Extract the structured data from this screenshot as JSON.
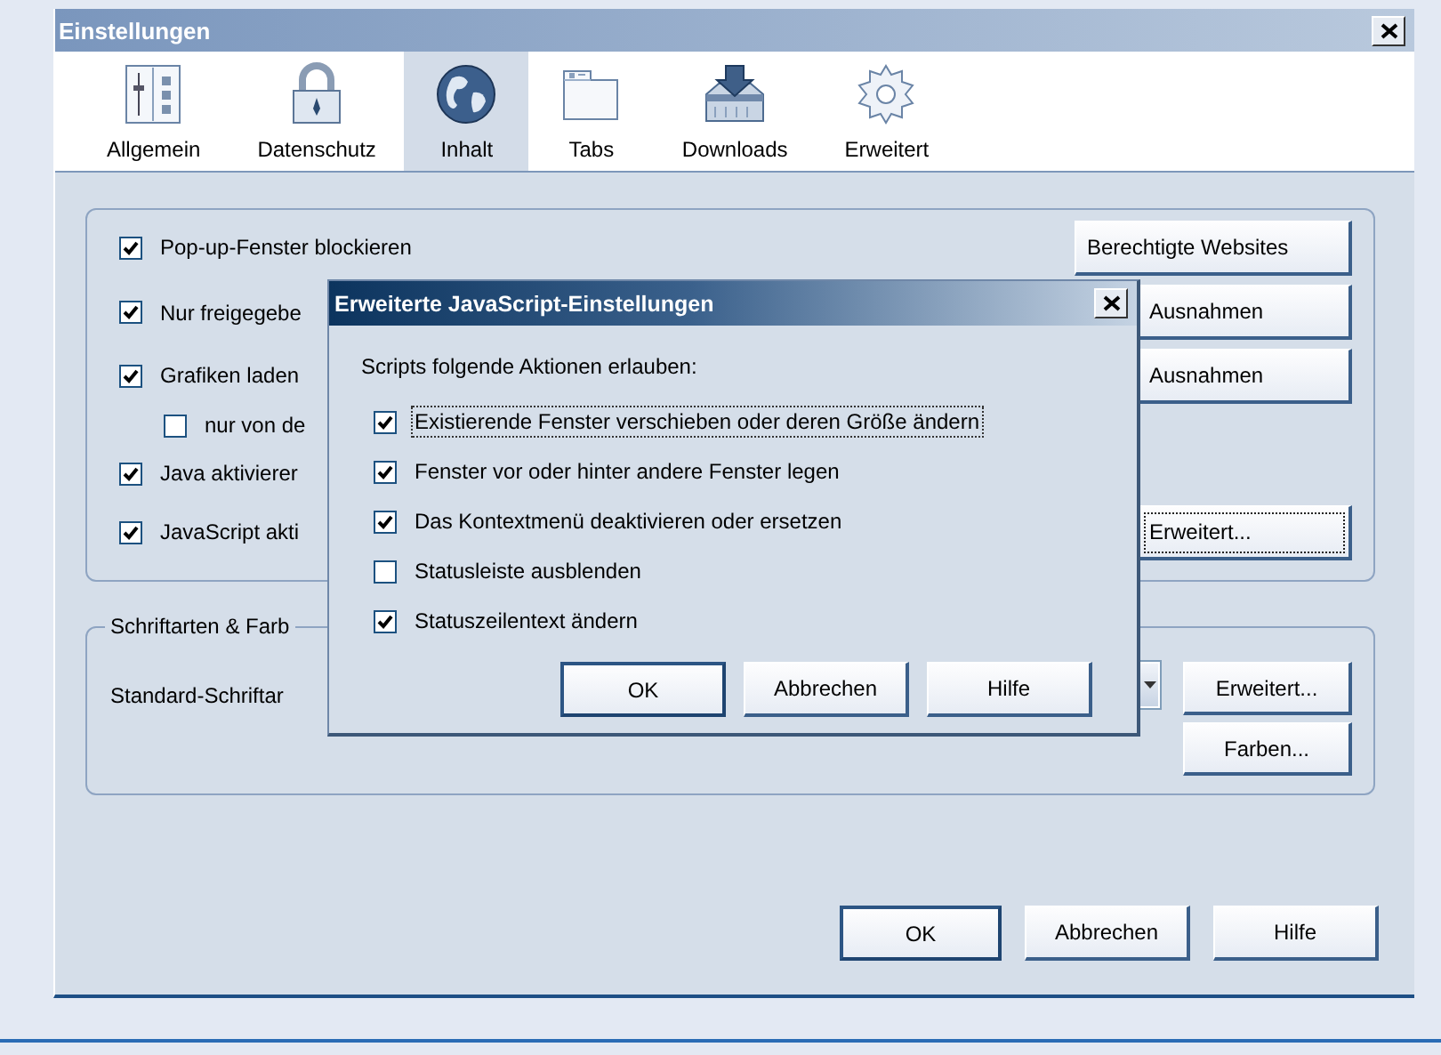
{
  "window": {
    "title": "Einstellungen"
  },
  "toolbar": [
    {
      "label": "Allgemein",
      "kind": "sliders",
      "selected": false
    },
    {
      "label": "Datenschutz",
      "kind": "lock",
      "selected": false
    },
    {
      "label": "Inhalt",
      "kind": "globe",
      "selected": true
    },
    {
      "label": "Tabs",
      "kind": "tabs",
      "selected": false
    },
    {
      "label": "Downloads",
      "kind": "tray",
      "selected": false
    },
    {
      "label": "Erweitert",
      "kind": "gear",
      "selected": false
    }
  ],
  "content_group": {
    "rows": [
      {
        "label": "Pop-up-Fenster blockieren",
        "checked": true,
        "button": {
          "label": "Berechtigte Websites",
          "focused": false
        }
      },
      {
        "label": "Nur freigegebe",
        "checked": true,
        "button": {
          "label": "Ausnahmen",
          "focused": false
        }
      },
      {
        "label": "Grafiken laden",
        "checked": true,
        "button": {
          "label": "Ausnahmen",
          "focused": false
        },
        "children": [
          {
            "label": "nur von de",
            "checked": false
          }
        ]
      },
      {
        "label": "Java aktivierer",
        "checked": true
      },
      {
        "label": "JavaScript akti",
        "checked": true,
        "button": {
          "label": "Erweitert...",
          "focused": true
        }
      }
    ]
  },
  "fonts_group": {
    "legend": "Schriftarten & Farb",
    "label": "Standard-Schriftar",
    "buttons": [
      "Erweitert...",
      "Farben..."
    ]
  },
  "buttons": [
    {
      "label": "OK",
      "default": true
    },
    {
      "label": "Abbrechen",
      "default": false
    },
    {
      "label": "Hilfe",
      "default": false
    }
  ],
  "dialog": {
    "title": "Erweiterte JavaScript-Einstellungen",
    "prompt": "Scripts folgende Aktionen erlauben:",
    "options": [
      {
        "label": "Existierende Fenster verschieben oder deren Größe ändern",
        "checked": true,
        "focused": true
      },
      {
        "label": "Fenster vor oder hinter andere Fenster legen",
        "checked": true,
        "focused": false
      },
      {
        "label": "Das Kontextmenü deaktivieren oder ersetzen",
        "checked": true,
        "focused": false
      },
      {
        "label": "Statusleiste ausblenden",
        "checked": false,
        "focused": false
      },
      {
        "label": "Statuszeilentext ändern",
        "checked": true,
        "focused": false
      }
    ],
    "buttons": [
      {
        "label": "OK",
        "default": true
      },
      {
        "label": "Abbrechen",
        "default": false
      },
      {
        "label": "Hilfe",
        "default": false
      }
    ]
  }
}
